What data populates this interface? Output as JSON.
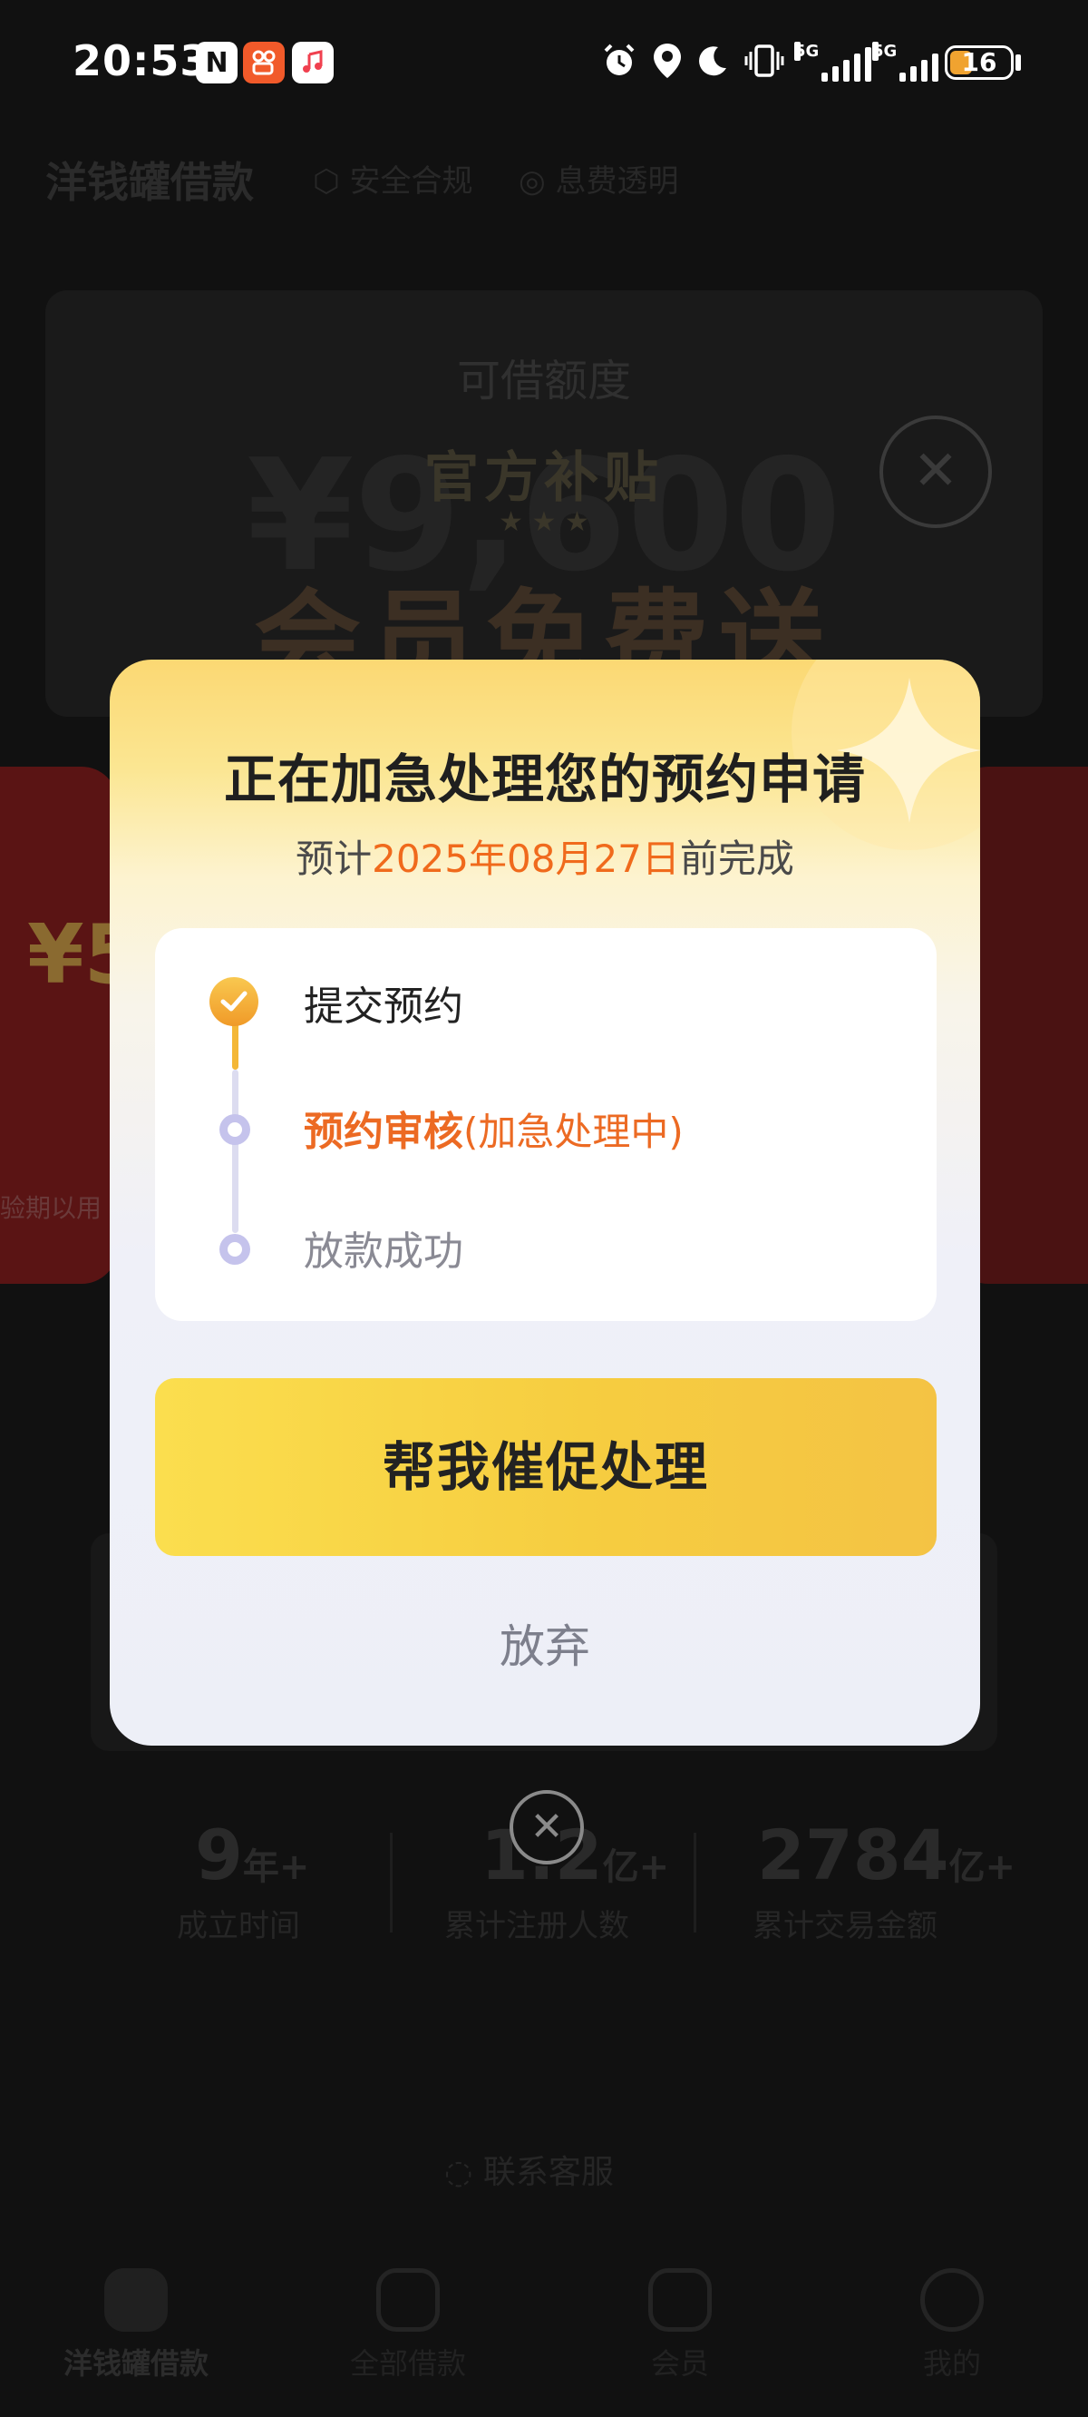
{
  "status_bar": {
    "time": "20:53",
    "nfc_icon": "N",
    "battery_level": "16",
    "signal1_label": "5G",
    "signal2_label": "5G",
    "icons": [
      "nfc-icon",
      "kuaishou-app-icon",
      "music-app-icon",
      "alarm-icon",
      "location-icon",
      "moon-icon",
      "vibrate-icon",
      "signal-icon",
      "battery-icon"
    ]
  },
  "background": {
    "app_title": "洋钱罐借款",
    "tag_safe": "⬡ 安全合规",
    "tag_transparent": "◎ 息费透明",
    "credit_label": "可借额度",
    "credit_amount": "¥9,600",
    "official_subsidy": "官方补贴",
    "stars": "★ ★ ★",
    "member_free": "会员免费送",
    "red_card_rmb": "¥5",
    "red_card_note": "验期以用",
    "stats": [
      {
        "num": "9",
        "unit": "年+",
        "label": "成立时间"
      },
      {
        "num": "1.2",
        "unit": "亿+",
        "label": "累计注册人数"
      },
      {
        "num": "2784",
        "unit": "亿+",
        "label": "累计交易金额"
      }
    ],
    "service": "联系客服",
    "tabs": [
      {
        "label": "洋钱罐借款"
      },
      {
        "label": "全部借款"
      },
      {
        "label": "会员"
      },
      {
        "label": "我的"
      }
    ]
  },
  "modal": {
    "title": "正在加急处理您的预约申请",
    "subtitle_prefix": "预计",
    "subtitle_date": "2025年08月27日",
    "subtitle_suffix": "前完成",
    "steps": [
      {
        "label": "提交预约"
      },
      {
        "label": "预约审核",
        "note": "(加急处理中)"
      },
      {
        "label": "放款成功"
      }
    ],
    "cta_label": "帮我催促处理",
    "giveup_label": "放弃",
    "close_glyph": "✕"
  },
  "colors": {
    "accent_orange": "#ec6a23",
    "button_yellow": "#f8d246",
    "step_done": "#f4b736",
    "step_todo": "#c5c3ec"
  }
}
